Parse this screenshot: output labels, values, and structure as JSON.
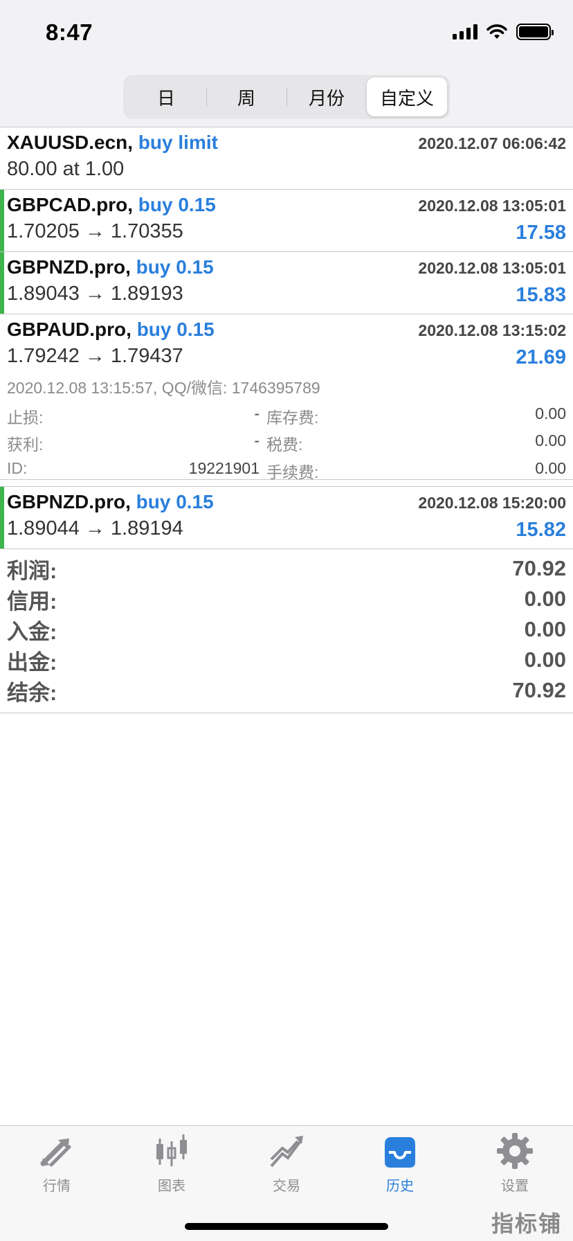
{
  "status": {
    "time": "8:47"
  },
  "segments": [
    {
      "label": "日"
    },
    {
      "label": "周"
    },
    {
      "label": "月份"
    },
    {
      "label": "自定义"
    }
  ],
  "orders": [
    {
      "symbol": "XAUUSD.ecn,",
      "type": "buy limit",
      "time": "2020.12.07 06:06:42",
      "prices": "80.00 at 1.00",
      "profit": ""
    },
    {
      "symbol": "GBPCAD.pro,",
      "type": "buy 0.15",
      "time": "2020.12.08 13:05:01",
      "prices": "1.70205 → 1.70355",
      "profit": "17.58"
    },
    {
      "symbol": "GBPNZD.pro,",
      "type": "buy 0.15",
      "time": "2020.12.08 13:05:01",
      "prices": "1.89043 → 1.89193",
      "profit": "15.83"
    },
    {
      "symbol": "GBPAUD.pro,",
      "type": "buy 0.15",
      "time": "2020.12.08 13:15:02",
      "prices": "1.79242 → 1.79437",
      "profit": "21.69"
    },
    {
      "symbol": "GBPNZD.pro,",
      "type": "buy 0.15",
      "time": "2020.12.08 15:20:00",
      "prices": "1.89044 → 1.89194",
      "profit": "15.82"
    }
  ],
  "detail": {
    "comment": "2020.12.08 13:15:57, QQ/微信: 1746395789",
    "rows": [
      {
        "label1": "止损:",
        "value1": "-",
        "label2": "库存费:",
        "value2": "0.00"
      },
      {
        "label1": "获利:",
        "value1": "-",
        "label2": "税费:",
        "value2": "0.00"
      },
      {
        "label1": "ID:",
        "value1": "19221901",
        "label2": "手续费:",
        "value2": "0.00"
      }
    ]
  },
  "summary": [
    {
      "label": "利润:",
      "value": "70.92"
    },
    {
      "label": "信用:",
      "value": "0.00"
    },
    {
      "label": "入金:",
      "value": "0.00"
    },
    {
      "label": "出金:",
      "value": "0.00"
    },
    {
      "label": "结余:",
      "value": "70.92"
    }
  ],
  "tabs": [
    {
      "label": "行情",
      "icon": "quotes-arrows-icon"
    },
    {
      "label": "图表",
      "icon": "candlestick-chart-icon"
    },
    {
      "label": "交易",
      "icon": "trade-trend-icon"
    },
    {
      "label": "历史",
      "icon": "history-inbox-icon",
      "active": true
    },
    {
      "label": "设置",
      "icon": "gear-icon"
    }
  ],
  "watermark": "指标铺",
  "colors": {
    "accent": "#2a7fdc",
    "bar": "#3db54a"
  }
}
